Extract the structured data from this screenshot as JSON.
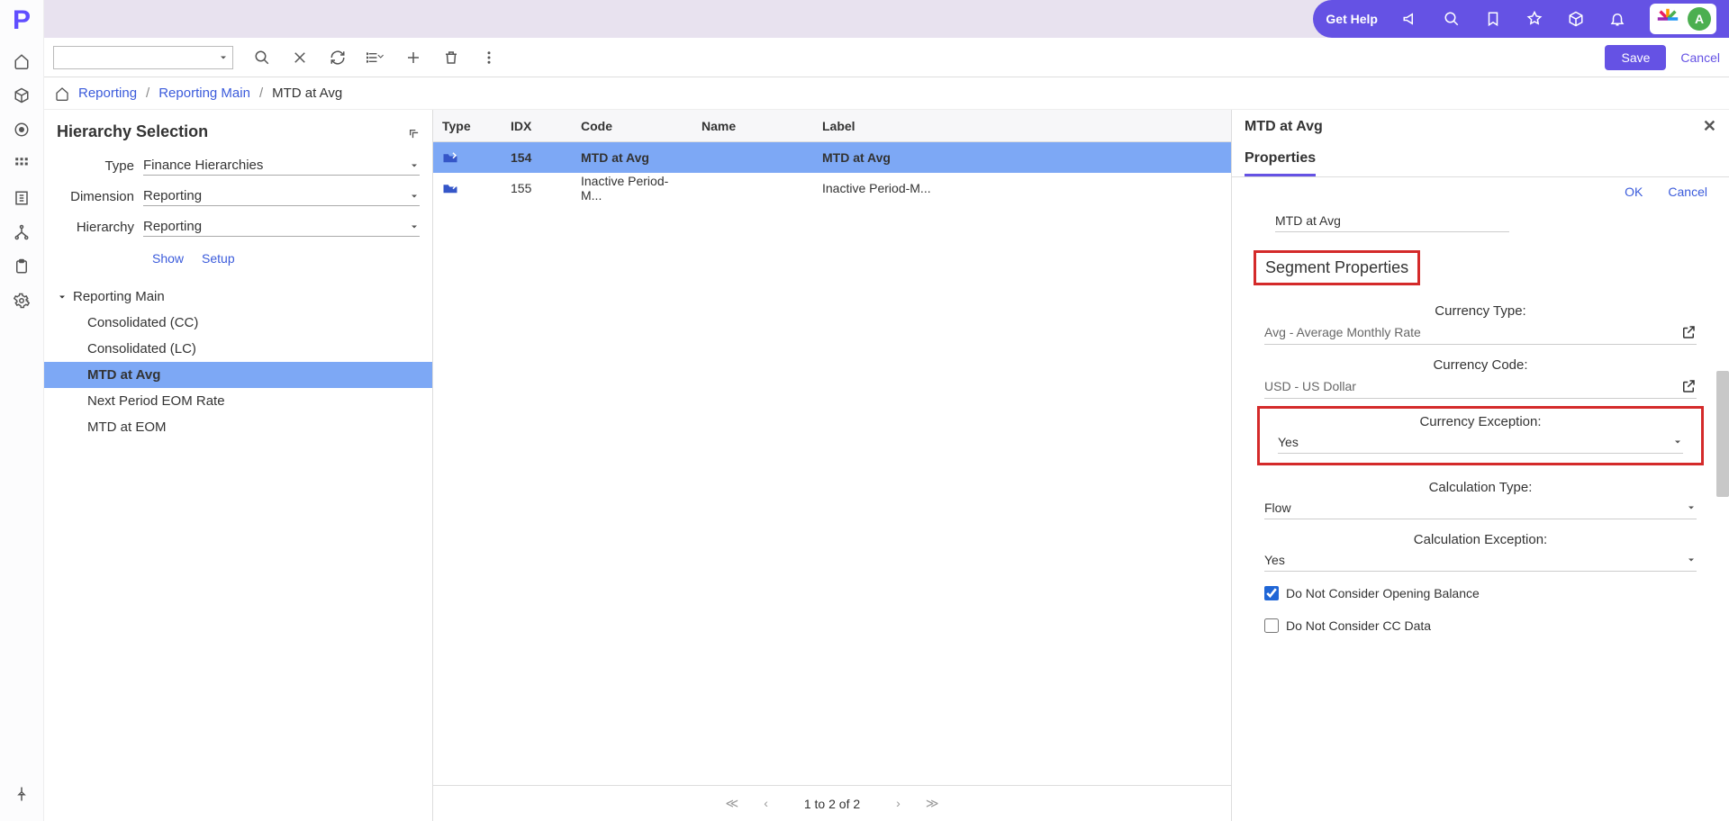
{
  "topbar": {
    "get_help": "Get Help",
    "avatar_letter": "A"
  },
  "toolbar": {
    "save_label": "Save",
    "cancel_label": "Cancel"
  },
  "breadcrumb": {
    "l1": "Reporting",
    "l2": "Reporting Main",
    "current": "MTD at Avg"
  },
  "hierarchy": {
    "title": "Hierarchy Selection",
    "type_label": "Type",
    "type_value": "Finance Hierarchies",
    "dimension_label": "Dimension",
    "dimension_value": "Reporting",
    "hierarchy_label": "Hierarchy",
    "hierarchy_value": "Reporting",
    "show": "Show",
    "setup": "Setup",
    "tree_root": "Reporting Main",
    "tree_items": [
      "Consolidated (CC)",
      "Consolidated (LC)",
      "MTD at Avg",
      "Next Period EOM Rate",
      "MTD at EOM"
    ],
    "selected_index": 2
  },
  "table": {
    "headers": {
      "type": "Type",
      "idx": "IDX",
      "code": "Code",
      "name": "Name",
      "label": "Label"
    },
    "rows": [
      {
        "idx": "154",
        "code": "MTD at Avg",
        "name": "",
        "label": "MTD at Avg",
        "selected": true
      },
      {
        "idx": "155",
        "code": "Inactive Period-M...",
        "name": "",
        "label": "Inactive Period-M...",
        "selected": false
      }
    ],
    "pager": "1 to 2 of 2"
  },
  "props": {
    "title": "MTD at Avg",
    "tab": "Properties",
    "ok": "OK",
    "cancel": "Cancel",
    "name_value": "MTD at Avg",
    "segment_heading": "Segment Properties",
    "currency_type_label": "Currency Type:",
    "currency_type_value": "Avg - Average Monthly Rate",
    "currency_code_label": "Currency Code:",
    "currency_code_value": "USD - US Dollar",
    "currency_exception_label": "Currency Exception:",
    "currency_exception_value": "Yes",
    "calculation_type_label": "Calculation Type:",
    "calculation_type_value": "Flow",
    "calculation_exception_label": "Calculation Exception:",
    "calculation_exception_value": "Yes",
    "cb_opening": "Do Not Consider Opening Balance",
    "cb_ccdata": "Do Not Consider CC Data"
  }
}
